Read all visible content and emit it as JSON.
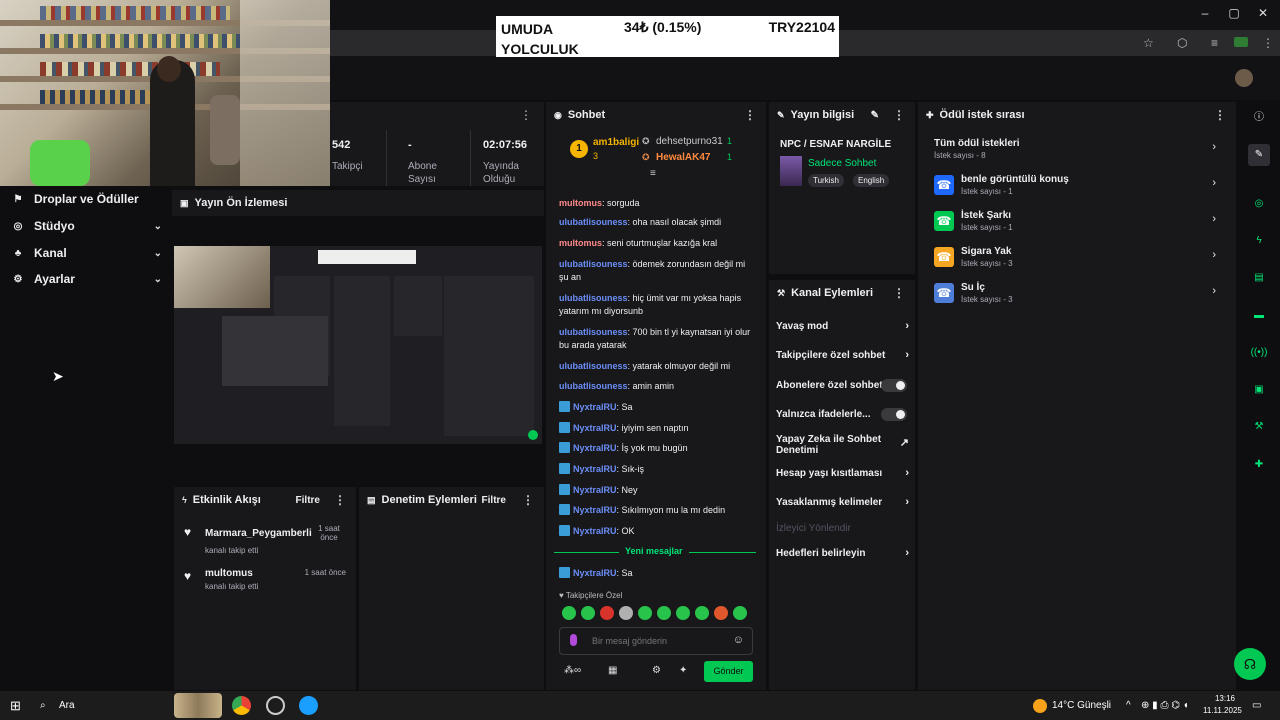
{
  "ticker": {
    "name": "UMUDA YOLCULUK",
    "change": "34₺ (0.15%)",
    "goal": "TRY22104"
  },
  "stats": {
    "followers_value": "542",
    "followers_label": "Takipçi",
    "subs_value": "-",
    "subs_label": "Abone Sayısı",
    "uptime_value": "02:07:56",
    "uptime_label": "Yayında Olduğu"
  },
  "nav": {
    "items": [
      {
        "label": "Droplar ve Ödüller",
        "icon": "gift-icon"
      },
      {
        "label": "Stüdyo",
        "icon": "studio-icon"
      },
      {
        "label": "Kanal",
        "icon": "channel-icon"
      },
      {
        "label": "Ayarlar",
        "icon": "gear-icon"
      }
    ]
  },
  "preview": {
    "title": "Yayın Ön İzlemesi"
  },
  "chat": {
    "title": "Sohbet",
    "leaderboard": [
      {
        "rank": "1",
        "name": "am1baligi",
        "count": "3"
      },
      {
        "name": "dehsetpurno31",
        "count": "1"
      },
      {
        "name": "HewalAK47",
        "count": "1"
      }
    ],
    "messages": [
      {
        "user": "multomus",
        "text": "sorguda"
      },
      {
        "user": "ulubatlisouness",
        "text": "oha nasıl olacak şimdi"
      },
      {
        "user": "multomus",
        "text": "seni oturtmuşlar kazığa kral"
      },
      {
        "user": "ulubatlisouness",
        "text": "ödemek zorundasın değil mi şu an"
      },
      {
        "user": "ulubatlisouness",
        "text": "hiç ümit var mı yoksa hapis yatarım mı diyorsunb"
      },
      {
        "user": "ulubatlisouness",
        "text": "700 bin tl yi kaynatsan iyi olur bu arada yatarak"
      },
      {
        "user": "ulubatlisouness",
        "text": "yatarak olmuyor değil mi"
      },
      {
        "user": "ulubatlisouness",
        "text": "amin amin"
      },
      {
        "user": "NyxtralRU",
        "text": "Sa"
      },
      {
        "user": "NyxtralRU",
        "text": "iyiyim sen naptın"
      },
      {
        "user": "NyxtralRU",
        "text": "İş yok mu bugün"
      },
      {
        "user": "NyxtralRU",
        "text": "Sık-iş"
      },
      {
        "user": "NyxtralRU",
        "text": "Ney"
      },
      {
        "user": "NyxtralRU",
        "text": "Sıkılmıyon mu la mı dedin"
      },
      {
        "user": "NyxtralRU",
        "text": "OK"
      }
    ],
    "new_messages_label": "Yeni mesajlar",
    "last_message": {
      "user": "NyxtralRU",
      "text": "Sa"
    },
    "followers_only": "Takipçilere Özel",
    "input_placeholder": "Bir mesaj gönderin",
    "send_label": "Gönder"
  },
  "stream_info": {
    "title": "Yayın bilgisi",
    "stream_title": "NPC / ESNAF NARGİLE",
    "category": "Sadece Sohbet",
    "tags": [
      "Turkish",
      "English"
    ]
  },
  "channel_actions": {
    "title": "Kanal Eylemleri",
    "items": [
      "Yavaş mod",
      "Takipçilere özel sohbet",
      "Abonelere özel sohbet",
      "Yalnızca ifadelerle...",
      "Yapay Zeka ile Sohbet Denetimi",
      "Hesap yaşı kısıtlaması",
      "Yasaklanmış kelimeler",
      "İzleyici Yönlendir",
      "Hedefleri belirleyin"
    ]
  },
  "rewards": {
    "title": "Ödül istek sırası",
    "all_title": "Tüm ödül istekleri",
    "all_count": "İstek sayısı - 8",
    "items": [
      {
        "title": "benle görüntülü konuş",
        "count": "İstek sayısı - 1",
        "color": "#1f69ff"
      },
      {
        "title": "İstek Şarkı",
        "count": "İstek sayısı - 1",
        "color": "#00c853"
      },
      {
        "title": "Sigara Yak",
        "count": "İstek sayısı - 3",
        "color": "#f5a623"
      },
      {
        "title": "Su İç",
        "count": "İstek sayısı - 3",
        "color": "#4f7ed8"
      }
    ]
  },
  "activity": {
    "title": "Etkinlik Akışı",
    "filter": "Filtre",
    "events": [
      {
        "user": "Marmara_Peygamberli",
        "action": "kanalı takip etti",
        "time": "1 saat önce"
      },
      {
        "user": "multomus",
        "action": "kanalı takip etti",
        "time": "1 saat önce"
      }
    ]
  },
  "moderation": {
    "title": "Denetim Eylemleri",
    "filter": "Filtre"
  },
  "taskbar": {
    "search": "Ara",
    "weather": "14°C Güneşli",
    "time": "13:16",
    "date": "11.11.2025"
  }
}
